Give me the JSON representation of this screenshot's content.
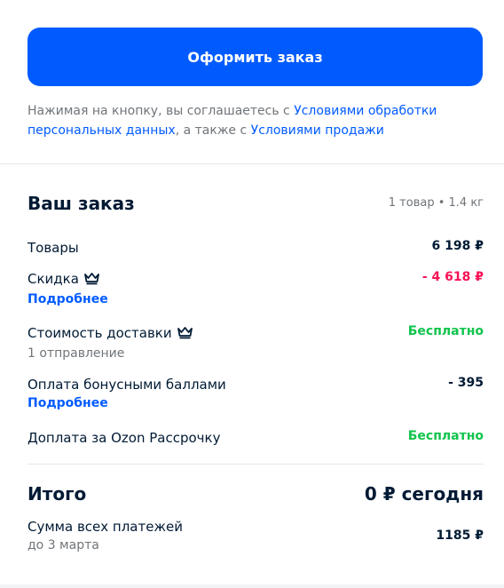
{
  "checkout": {
    "button_label": "Оформить заказ",
    "agreement_prefix": "Нажимая на кнопку, вы соглашаетесь с ",
    "agreement_link_1": "Условиями обработки персональных данных",
    "agreement_middle": ", а также с ",
    "agreement_link_2": "Условиями продажи"
  },
  "order": {
    "title": "Ваш заказ",
    "meta": "1 товар • 1.4 кг",
    "lines": [
      {
        "label": "Товары",
        "value": "6 198 ₽"
      },
      {
        "label": "Скидка",
        "link": "Подробнее",
        "value": "- 4 618 ₽"
      },
      {
        "label": "Стоимость доставки",
        "subtext": "1 отправление",
        "value": "Бесплатно"
      },
      {
        "label": "Оплата бонусными баллами",
        "link": "Подробнее",
        "value": "- 395"
      },
      {
        "label": "Доплата за Ozon Рассрочку",
        "value": "Бесплатно"
      }
    ],
    "total_label": "Итого",
    "total_value": "0 ₽ сегодня",
    "payments_label": "Сумма всех платежей",
    "payments_sub": "до 3 марта",
    "payments_value": "1185 ₽"
  },
  "colors": {
    "accent": "#005bff",
    "discount": "#f91155",
    "free": "#10c44c"
  },
  "icons": {
    "premium": "crown-icon"
  }
}
